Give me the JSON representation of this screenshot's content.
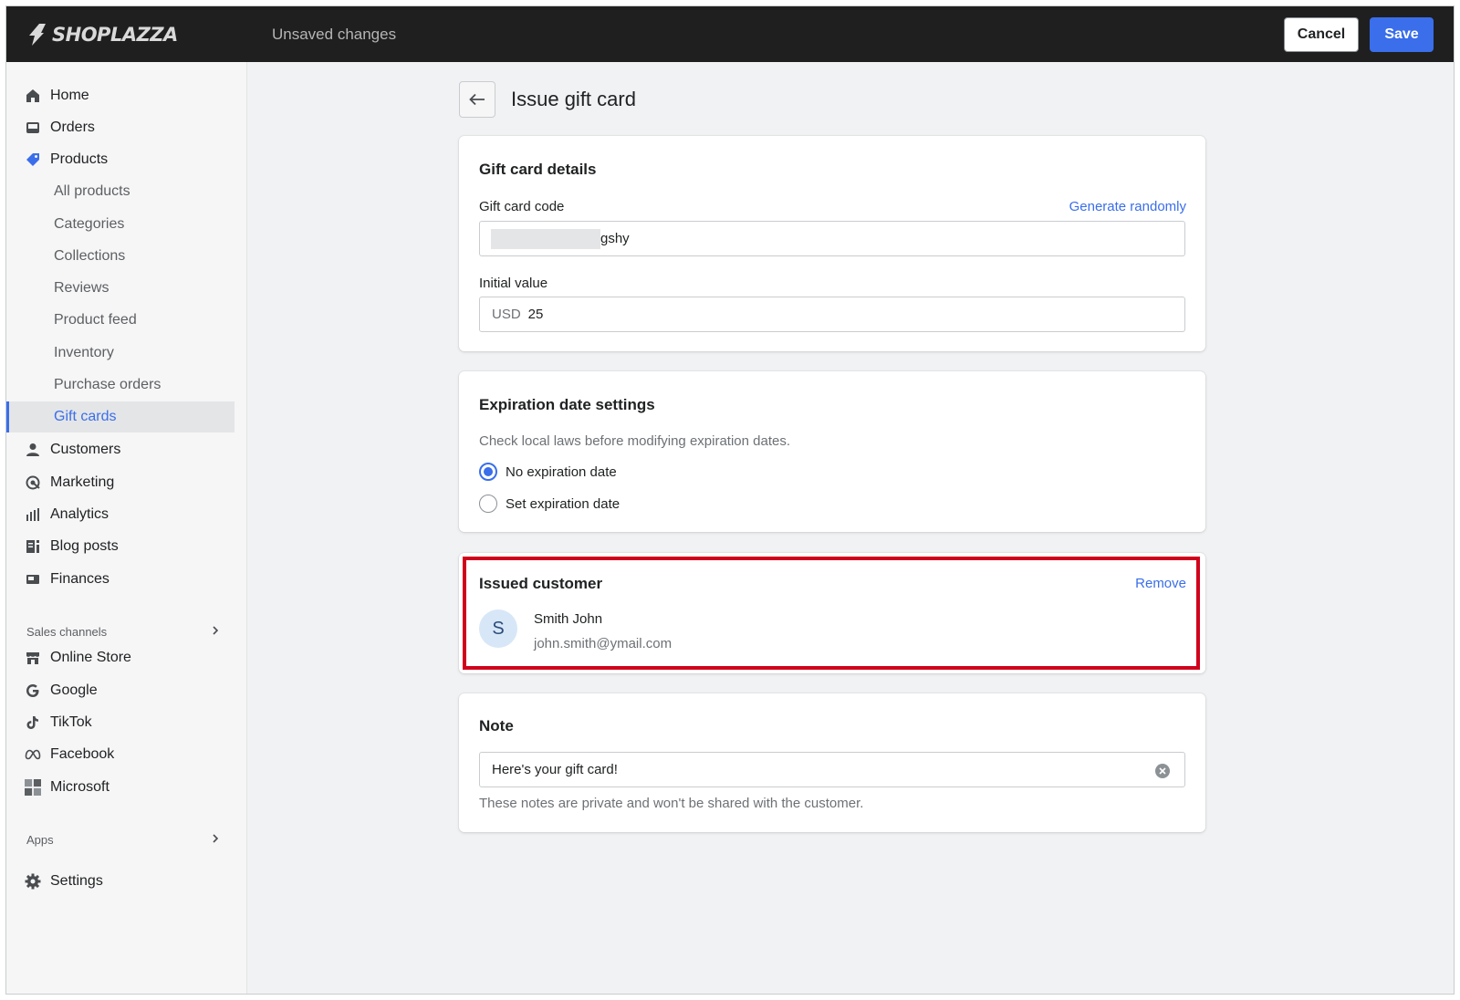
{
  "topbar": {
    "brand": "SHOPLAZZA",
    "status": "Unsaved changes",
    "cancel_label": "Cancel",
    "save_label": "Save"
  },
  "sidebar": {
    "items": [
      {
        "label": "Home",
        "icon": "home-icon"
      },
      {
        "label": "Orders",
        "icon": "inbox-icon"
      },
      {
        "label": "Products",
        "icon": "tag-icon"
      },
      {
        "label": "All products"
      },
      {
        "label": "Categories"
      },
      {
        "label": "Collections"
      },
      {
        "label": "Reviews"
      },
      {
        "label": "Product feed"
      },
      {
        "label": "Inventory"
      },
      {
        "label": "Purchase orders"
      },
      {
        "label": "Gift cards",
        "active": true
      },
      {
        "label": "Customers",
        "icon": "person-icon"
      },
      {
        "label": "Marketing",
        "icon": "target-icon"
      },
      {
        "label": "Analytics",
        "icon": "bar-chart-icon"
      },
      {
        "label": "Blog posts",
        "icon": "blog-icon"
      },
      {
        "label": "Finances",
        "icon": "finance-icon"
      }
    ],
    "sales_channels_label": "Sales channels",
    "channels": [
      {
        "label": "Online Store",
        "icon": "store-icon"
      },
      {
        "label": "Google",
        "icon": "google-icon"
      },
      {
        "label": "TikTok",
        "icon": "tiktok-icon"
      },
      {
        "label": "Facebook",
        "icon": "meta-icon"
      },
      {
        "label": "Microsoft",
        "icon": "microsoft-icon"
      }
    ],
    "apps_label": "Apps",
    "settings_label": "Settings"
  },
  "page": {
    "title": "Issue gift card"
  },
  "gift_card_details": {
    "title": "Gift card details",
    "code_label": "Gift card code",
    "generate_label": "Generate randomly",
    "code_value_visible": "gshy",
    "initial_value_label": "Initial value",
    "currency": "USD",
    "initial_value": "25"
  },
  "expiration": {
    "title": "Expiration date settings",
    "hint": "Check local laws before modifying expiration dates.",
    "options": [
      {
        "label": "No expiration date",
        "selected": true
      },
      {
        "label": "Set expiration date",
        "selected": false
      }
    ]
  },
  "issued_customer": {
    "title": "Issued customer",
    "remove_label": "Remove",
    "avatar_initial": "S",
    "name": "Smith John",
    "email": "john.smith@ymail.com"
  },
  "note": {
    "title": "Note",
    "value": "Here's your gift card!",
    "help": "These notes are private and won't be shared with the customer."
  },
  "colors": {
    "accent": "#3a6eea",
    "topbar": "#1f1f1f",
    "highlight": "#d0021b"
  }
}
